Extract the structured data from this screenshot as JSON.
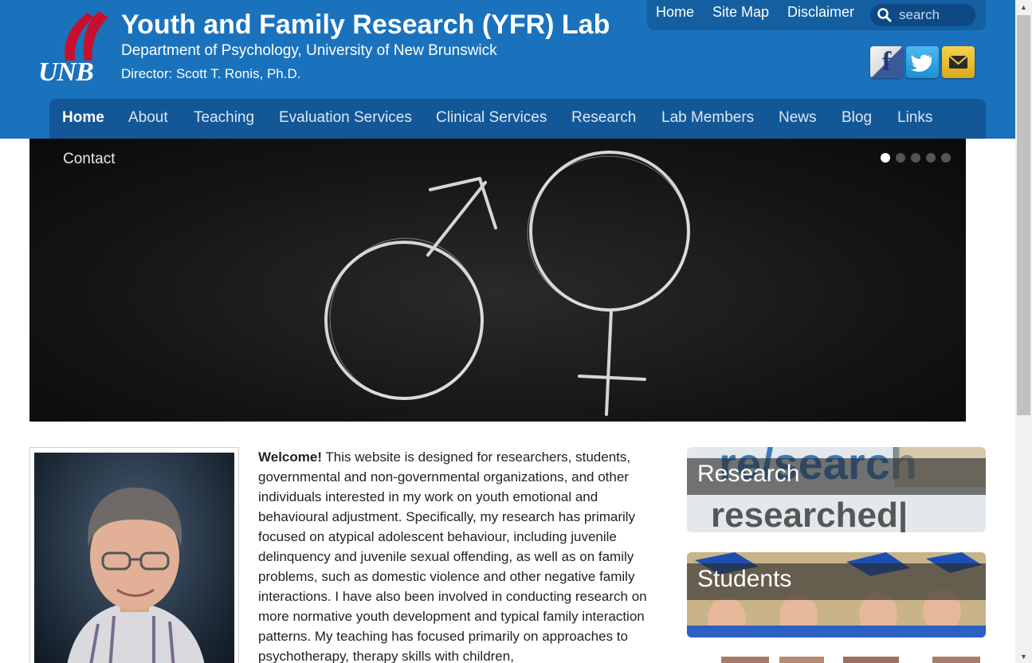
{
  "header": {
    "title": "Youth and Family Research (YFR) Lab",
    "subtitle": "Department of Psychology, University of New Brunswick",
    "director": "Director: Scott T. Ronis, Ph.D.",
    "logo_text": "UNB",
    "brand_color": "#1a72bd"
  },
  "utility_nav": {
    "items": [
      "Home",
      "Site Map",
      "Disclaimer"
    ],
    "search_placeholder": "search"
  },
  "social": {
    "facebook_glyph": "f",
    "twitter_icon": "twitter-icon",
    "email_icon": "mail-icon"
  },
  "main_nav": {
    "items": [
      "Home",
      "About",
      "Teaching",
      "Evaluation Services",
      "Clinical Services",
      "Research",
      "Lab Members",
      "News",
      "Blog",
      "Links",
      "Contact"
    ],
    "active": "Home"
  },
  "slider": {
    "slide_count": 5,
    "active_index": 0
  },
  "welcome": {
    "lead": "Welcome!",
    "body": " This website is designed for researchers, students, governmental and non-governmental organizations, and other individuals interested in my work on youth emotional and behavioural adjustment. Specifically, my research has primarily focused on atypical adolescent behaviour, including juvenile delinquency and juvenile sexual offending, as well as on family problems, such as domestic violence and other negative family interactions. I have also been involved in conducting research on more normative youth development and typical family interaction patterns. My teaching has focused primarily on approaches to psychotherapy, therapy skills with children,"
  },
  "tiles": {
    "research": "Research",
    "students": "Students"
  }
}
